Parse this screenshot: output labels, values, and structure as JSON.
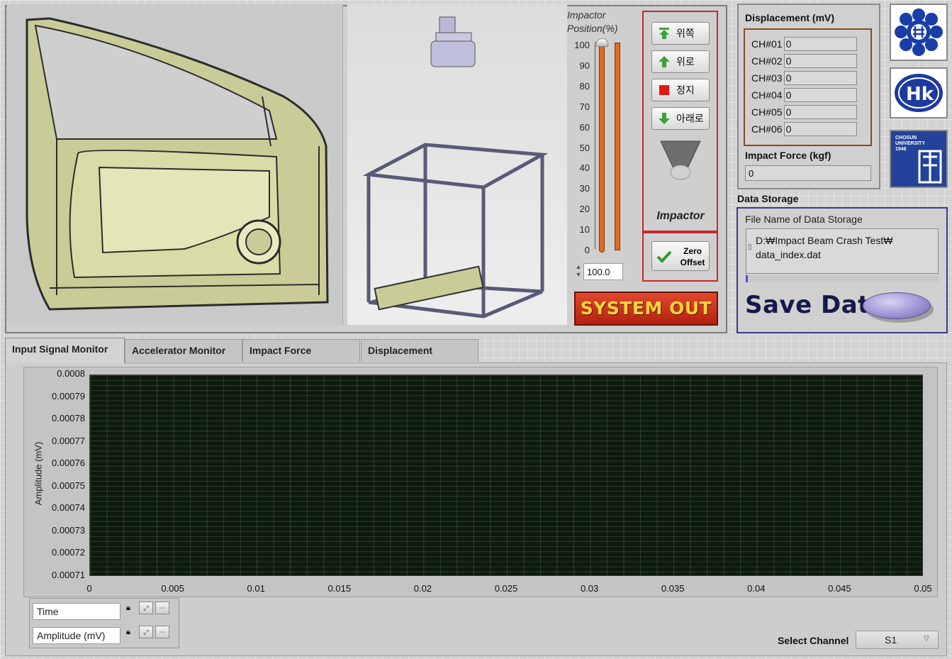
{
  "slider": {
    "title": "Impactor Position(%)",
    "ticks": [
      "100",
      "90",
      "80",
      "70",
      "60",
      "50",
      "40",
      "30",
      "20",
      "10",
      "0"
    ],
    "value": "100.0",
    "level_percent": 100
  },
  "impactor": {
    "buttons": {
      "top": "위쪽",
      "up": "위로",
      "stop": "정지",
      "down": "아래로"
    },
    "label": "Impactor",
    "zero_offset": "Zero Offset",
    "system_out": "SYSTEM OUT"
  },
  "displacement": {
    "title": "Displacement (mV)",
    "channels": [
      {
        "label": "CH#01",
        "value": "0"
      },
      {
        "label": "CH#02",
        "value": "0"
      },
      {
        "label": "CH#03",
        "value": "0"
      },
      {
        "label": "CH#04",
        "value": "0"
      },
      {
        "label": "CH#05",
        "value": "0"
      },
      {
        "label": "CH#06",
        "value": "0"
      }
    ],
    "force_title": "Impact Force (kgf)",
    "force_value": "0"
  },
  "logos": {
    "logo3_text": "CHOSUN UNIVERSITY 1946"
  },
  "storage": {
    "title": "Data Storage",
    "file_label": "File Name of Data Storage",
    "file_line1": "D:₩Impact Beam Crash Test₩",
    "file_line2": "data_index.dat",
    "save_label": "Save Data"
  },
  "tabs": [
    "Input Signal Monitor",
    "Accelerator Monitor",
    "Impact Force",
    "Displacement"
  ],
  "legend": {
    "x_name": "Time",
    "y_name": "Amplitude (mV)"
  },
  "channel": {
    "label": "Select Channel",
    "value": "S1"
  },
  "colors": {
    "slider": "#e36a1b",
    "system_out": "#c8301a",
    "plot_bg": "#0d1a0d",
    "panel_border_red": "#c8292b"
  },
  "chart_data": {
    "type": "line",
    "title": "",
    "xlabel": "",
    "ylabel": "Amplitude (mV)",
    "xlim": [
      0,
      0.05
    ],
    "ylim": [
      0.00071,
      0.0008
    ],
    "x_ticks": [
      "0",
      "0.005",
      "0.01",
      "0.015",
      "0.02",
      "0.025",
      "0.03",
      "0.035",
      "0.04",
      "0.045",
      "0.05"
    ],
    "y_ticks": [
      "0.0008",
      "0.00079",
      "0.00078",
      "0.00077",
      "0.00076",
      "0.00075",
      "0.00074",
      "0.00073",
      "0.00072",
      "0.00071"
    ],
    "grid": true,
    "series": []
  }
}
